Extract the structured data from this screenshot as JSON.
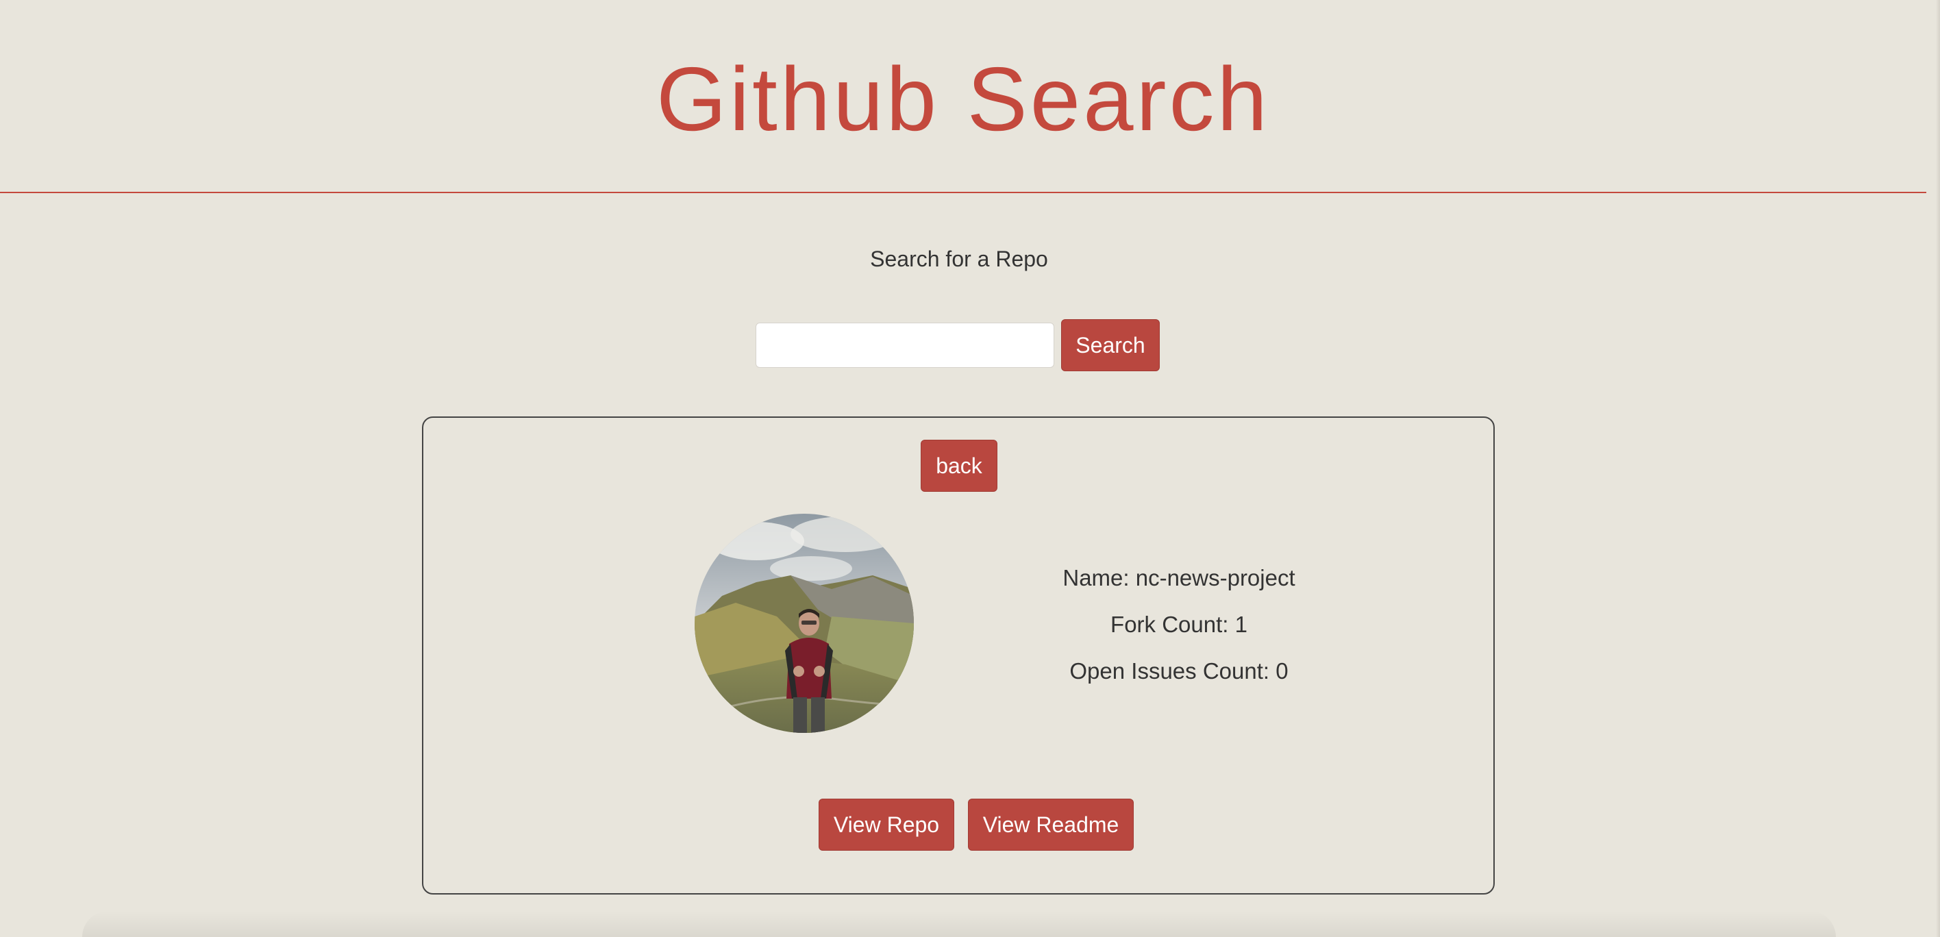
{
  "header": {
    "title": "Github Search"
  },
  "search": {
    "label": "Search for a Repo",
    "input_value": "",
    "button_label": "Search"
  },
  "repo_card": {
    "back_label": "back",
    "name_line": "Name: nc-news-project",
    "fork_line": "Fork Count: 1",
    "issues_line": "Open Issues Count: 0",
    "view_repo_label": "View Repo",
    "view_readme_label": "View Readme"
  },
  "colors": {
    "background": "#e8e5dc",
    "accent": "#c4493d",
    "button": "#b9473f"
  }
}
